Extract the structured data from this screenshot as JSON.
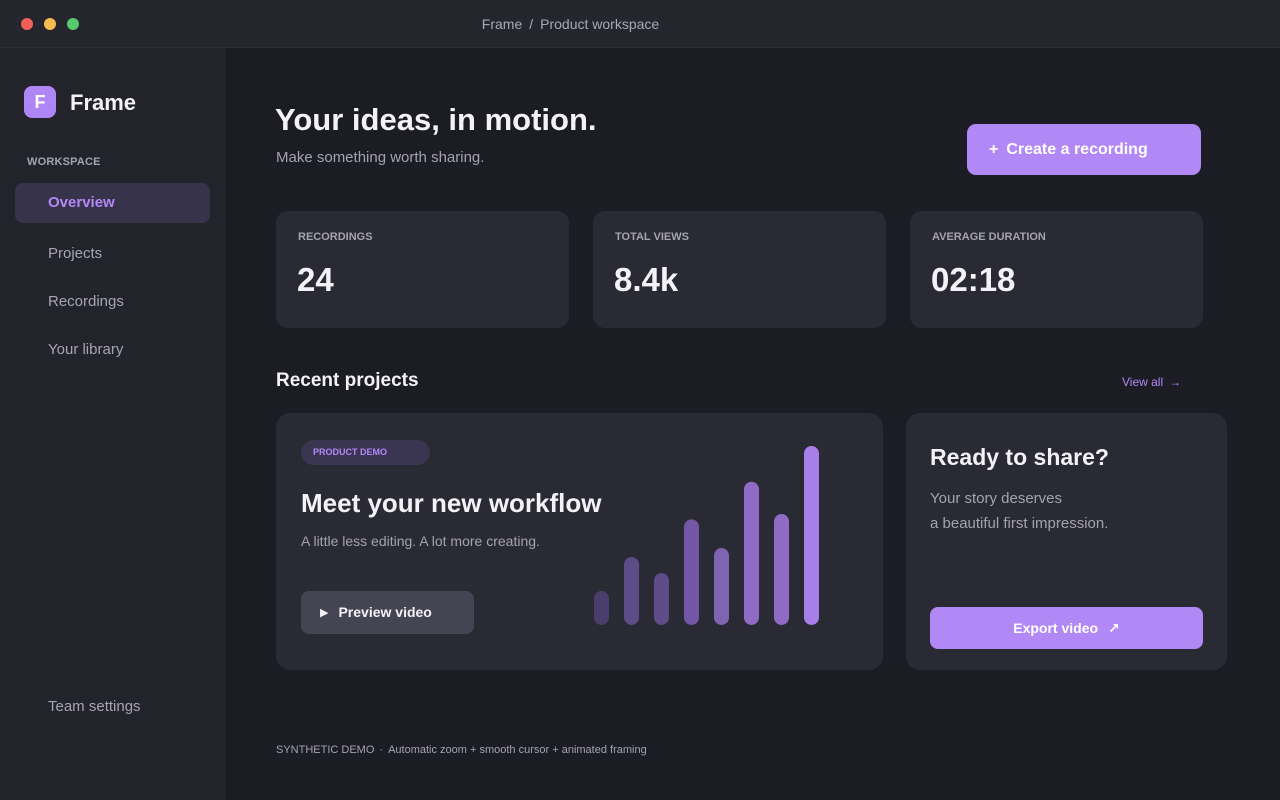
{
  "window": {
    "breadcrumb": [
      "Frame",
      "Product workspace"
    ],
    "breadcrumb_separator": "/"
  },
  "sidebar": {
    "logo_letter": "F",
    "app_name": "Frame",
    "section_label": "WORKSPACE",
    "items": [
      {
        "label": "Overview",
        "active": true
      },
      {
        "label": "Projects",
        "active": false
      },
      {
        "label": "Recordings",
        "active": false
      },
      {
        "label": "Your library",
        "active": false
      }
    ],
    "bottom_item": "Team settings"
  },
  "header": {
    "title": "Your ideas, in motion.",
    "subtitle": "Make something worth sharing.",
    "cta_icon": "+",
    "cta_label": "Create a recording"
  },
  "stats": [
    {
      "label": "RECORDINGS",
      "value": "24"
    },
    {
      "label": "TOTAL VIEWS",
      "value": "8.4k"
    },
    {
      "label": "AVERAGE DURATION",
      "value": "02:18"
    }
  ],
  "recent": {
    "title": "Recent projects",
    "view_all": "View all",
    "view_all_icon": "→"
  },
  "project_card": {
    "tag": "PRODUCT DEMO",
    "title": "Meet your new workflow",
    "subtitle": "A little less editing. A lot more creating.",
    "button_icon": "▶",
    "button_label": "Preview video",
    "bar_levels": [
      0.19,
      0.38,
      0.29,
      0.59,
      0.43,
      0.8,
      0.62,
      1.0
    ]
  },
  "share_card": {
    "title": "Ready to share?",
    "lines": [
      "Your story deserves",
      "a beautiful first impression."
    ],
    "button_label": "Export video",
    "button_icon": "↗"
  },
  "footer": {
    "label": "SYNTHETIC DEMO",
    "separator": "·",
    "text": "Automatic zoom + smooth cursor + animated framing"
  },
  "colors": {
    "accent": "#b287f6",
    "background": "#1c1c24",
    "sidebar": "#23232b",
    "card": "#2a2a34",
    "muted_text": "#a4a3b0"
  }
}
